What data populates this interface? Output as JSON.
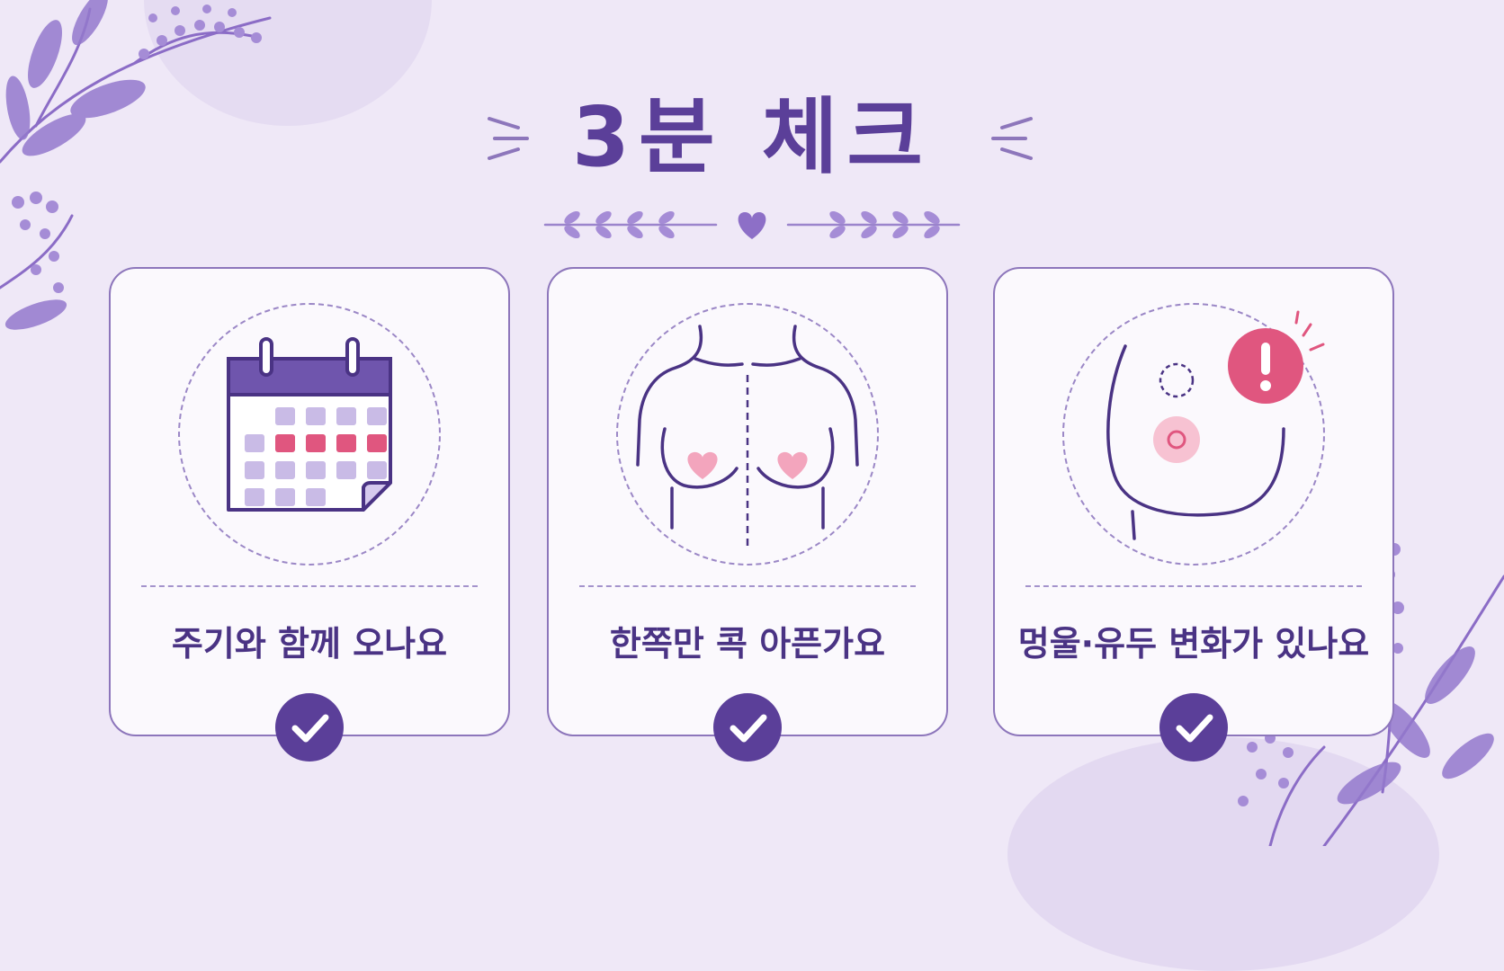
{
  "title": "3분 체크",
  "colors": {
    "background": "#efe8f7",
    "accent": "#5b3f99",
    "card_border": "#8d76bb",
    "pink": "#e0567f",
    "leaf": "#8b6cc6"
  },
  "cards": [
    {
      "label": "주기와 함께 오나요",
      "icon": "calendar-icon"
    },
    {
      "label": "한쪽만 콕 아픈가요",
      "icon": "chest-outline-icon"
    },
    {
      "label": "멍울·유두 변화가 있나요",
      "icon": "breast-lump-alert-icon"
    }
  ],
  "check_icon": "check-circle-icon"
}
